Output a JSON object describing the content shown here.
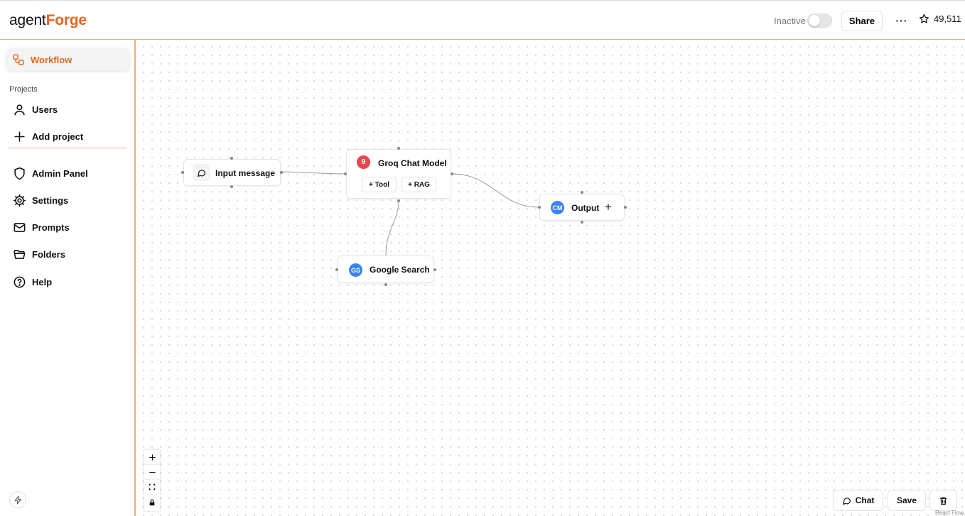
{
  "header": {
    "logo_part1": "agent",
    "logo_part2": "Forge",
    "status_label": "Inactive",
    "share_label": "Share",
    "more_label": "···",
    "star_count": "49,511"
  },
  "sidebar": {
    "active_item": "Workflow",
    "section_label": "Projects",
    "project_items": [
      {
        "label": "Users",
        "icon": "user-icon"
      },
      {
        "label": "Add project",
        "icon": "plus-icon"
      }
    ],
    "items": [
      {
        "label": "Admin Panel",
        "icon": "shield-icon"
      },
      {
        "label": "Settings",
        "icon": "gear-icon"
      },
      {
        "label": "Prompts",
        "icon": "mail-icon"
      },
      {
        "label": "Folders",
        "icon": "folder-icon"
      },
      {
        "label": "Help",
        "icon": "help-circle-icon"
      }
    ]
  },
  "canvas": {
    "nodes": {
      "input": {
        "title": "Input message",
        "icon": "message-circle-icon"
      },
      "groq": {
        "title": "Groq Chat Model",
        "badge": "9",
        "badge_color": "#e5484d",
        "tool_label": "+ Tool",
        "rag_label": "+ RAG"
      },
      "output": {
        "title": "Output",
        "badge": "CM",
        "badge_color": "#3b82f6",
        "add_label": "+"
      },
      "google": {
        "title": "Google Search",
        "badge": "GS",
        "badge_color": "#3b82f6"
      }
    },
    "controls": [
      "zoom-in-icon",
      "zoom-out-icon",
      "fit-view-icon",
      "lock-icon"
    ],
    "footer": {
      "chat_label": "Chat",
      "save_label": "Save",
      "attribution": "React Flow"
    }
  },
  "colors": {
    "accent": "#e8661c",
    "border_accent": "#f3a979"
  }
}
